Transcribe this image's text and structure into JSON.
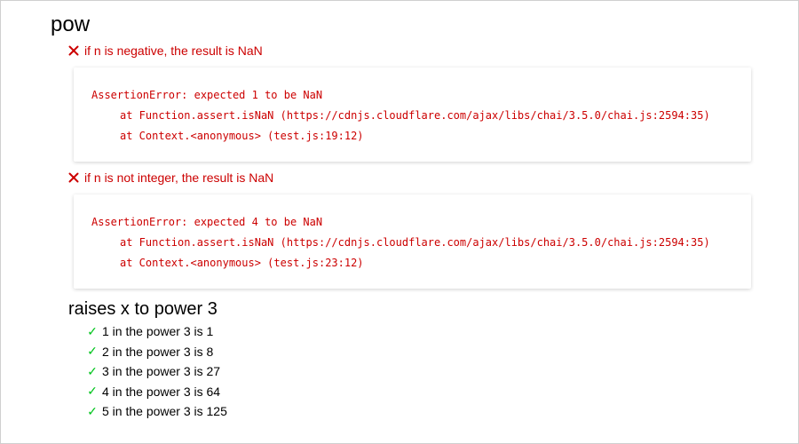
{
  "suite": {
    "title": "pow"
  },
  "failures": [
    {
      "title": "if n is negative, the result is NaN",
      "error_lines": [
        "AssertionError: expected 1 to be NaN",
        "at Function.assert.isNaN (https://cdnjs.cloudflare.com/ajax/libs/chai/3.5.0/chai.js:2594:35)",
        "at Context.<anonymous> (test.js:19:12)"
      ]
    },
    {
      "title": "if n is not integer, the result is NaN",
      "error_lines": [
        "AssertionError: expected 4 to be NaN",
        "at Function.assert.isNaN (https://cdnjs.cloudflare.com/ajax/libs/chai/3.5.0/chai.js:2594:35)",
        "at Context.<anonymous> (test.js:23:12)"
      ]
    }
  ],
  "subsuite": {
    "title": "raises x to power 3",
    "tests": [
      "1 in the power 3 is 1",
      "2 in the power 3 is 8",
      "3 in the power 3 is 27",
      "4 in the power 3 is 64",
      "5 in the power 3 is 125"
    ]
  },
  "icons": {
    "fail": "cross-icon",
    "pass": "check-icon"
  },
  "colors": {
    "fail": "#cc0000",
    "pass": "#00c41c"
  }
}
